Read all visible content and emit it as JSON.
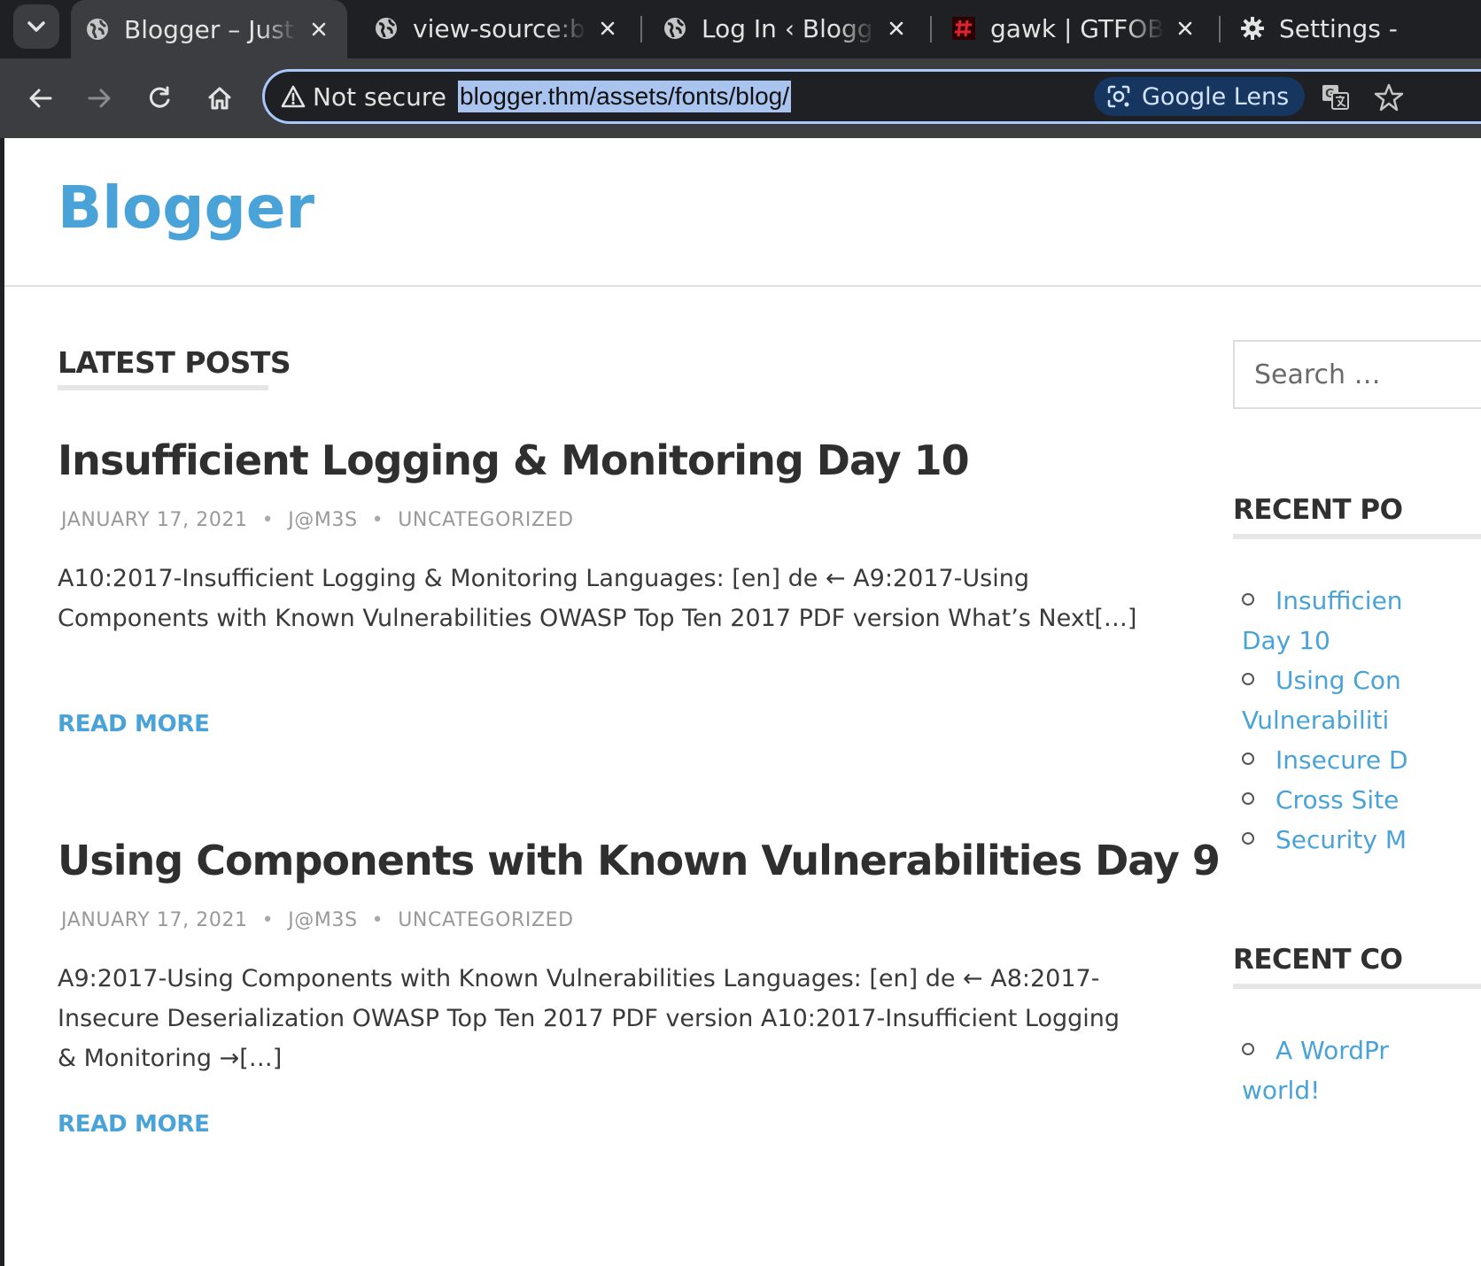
{
  "browser": {
    "tabs": [
      {
        "title": "Blogger – Just a",
        "icon": "globe-icon",
        "active": true
      },
      {
        "title": "view-source:blo",
        "icon": "globe-icon",
        "active": false
      },
      {
        "title": "Log In ‹ Blogger",
        "icon": "globe-icon",
        "active": false
      },
      {
        "title": "gawk | GTFOBin",
        "icon": "gtfobins-icon",
        "active": false
      },
      {
        "title": "Settings -",
        "icon": "gear-icon",
        "active": false
      }
    ],
    "security_label": "Not secure",
    "url": "blogger.thm/assets/fonts/blog/",
    "lens_label": "Google Lens",
    "colors": {
      "chrome_dark": "#1f2023",
      "chrome_toolbar": "#3c3d41",
      "omnibox_border": "#a8c7fa"
    }
  },
  "site": {
    "title": "Blogger",
    "accent_color": "#4aa3d8"
  },
  "main": {
    "section_heading": "LATEST POSTS",
    "posts": [
      {
        "title": "Insufficient Logging & Monitoring Day 10",
        "date": "JANUARY 17, 2021",
        "author": "J@M3S",
        "category": "UNCATEGORIZED",
        "excerpt": "A10:2017-Insufficient Logging & Monitoring Languages: [en] de ← A9:2017-Using Components with Known Vulnerabilities OWASP Top Ten 2017 PDF version What’s Next[…]",
        "read_more": "READ MORE"
      },
      {
        "title": "Using Components with Known Vulnerabilities Day 9",
        "date": "JANUARY 17, 2021",
        "author": "J@M3S",
        "category": "UNCATEGORIZED",
        "excerpt": "A9:2017-Using Components with Known Vulnerabilities Languages: [en] de ← A8:2017-Insecure Deserialization OWASP Top Ten 2017 PDF version A10:2017-Insufficient Logging & Monitoring →[…]",
        "read_more": "READ MORE"
      }
    ]
  },
  "sidebar": {
    "search_placeholder": "Search …",
    "recent_posts_heading": "RECENT PO",
    "recent_posts": [
      {
        "line1": "Insufficien",
        "line2": "Day 10"
      },
      {
        "line1": "Using Con",
        "line2": "Vulnerabiliti"
      },
      {
        "line1": "Insecure D",
        "line2": ""
      },
      {
        "line1": "Cross Site",
        "line2": ""
      },
      {
        "line1": "Security M",
        "line2": ""
      }
    ],
    "recent_comments_heading": "RECENT CO",
    "recent_comments": [
      {
        "line1": "A WordPr",
        "line2": "world!"
      }
    ]
  }
}
